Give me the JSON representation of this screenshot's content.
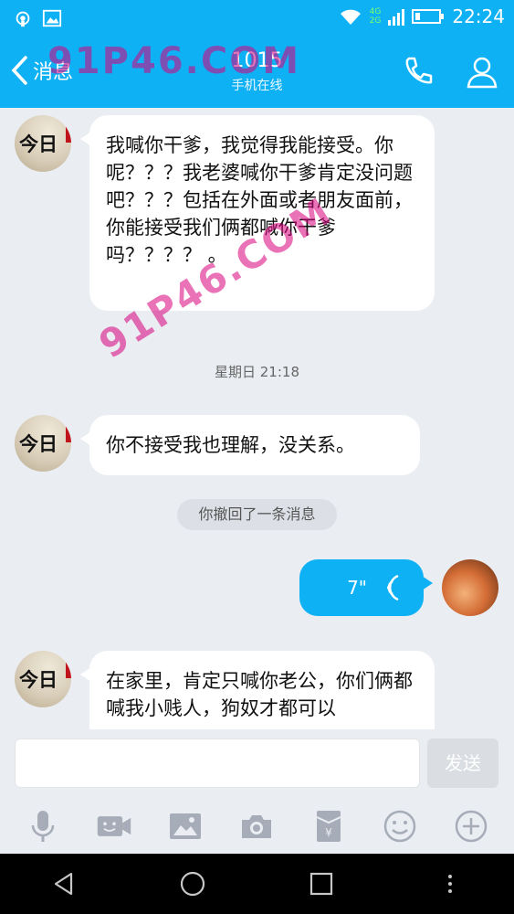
{
  "status_bar": {
    "time": "22:24",
    "network_top": "4G",
    "network_bottom": "2G"
  },
  "header": {
    "back_label": "消息",
    "title": "1015",
    "subtitle": "手机在线"
  },
  "watermark": {
    "text_top": "91P46.COM",
    "text_diag": "91P46.COM"
  },
  "messages": [
    {
      "side": "left",
      "avatar_text": "今日",
      "text": "我喊你干爹，我觉得我能接受。你呢？？？我老婆喊你干爹肯定没问题吧？？？包括在外面或者朋友面前，你能接受我们俩都喊你干爹吗？？？？ 。"
    },
    {
      "type": "timestamp",
      "text": "星期日 21:18"
    },
    {
      "side": "left",
      "avatar_text": "今日",
      "text": "你不接受我也理解，没关系。"
    },
    {
      "type": "system",
      "text": "你撤回了一条消息"
    },
    {
      "side": "right",
      "type": "voice",
      "duration": "7\""
    },
    {
      "side": "left",
      "avatar_text": "今日",
      "text": "在家里，肯定只喊你老公，你们俩都喊我小贱人，狗奴才都可以"
    }
  ],
  "input": {
    "placeholder": "",
    "send_label": "发送"
  },
  "toolbar_icons": [
    "microphone-icon",
    "video-icon",
    "image-icon",
    "camera-icon",
    "red-packet-icon",
    "emoji-icon",
    "plus-icon"
  ],
  "colors": {
    "brand": "#0fb1f5",
    "background": "#eaedf2",
    "bubble_left": "#ffffff",
    "bubble_right": "#0fb1f5"
  }
}
